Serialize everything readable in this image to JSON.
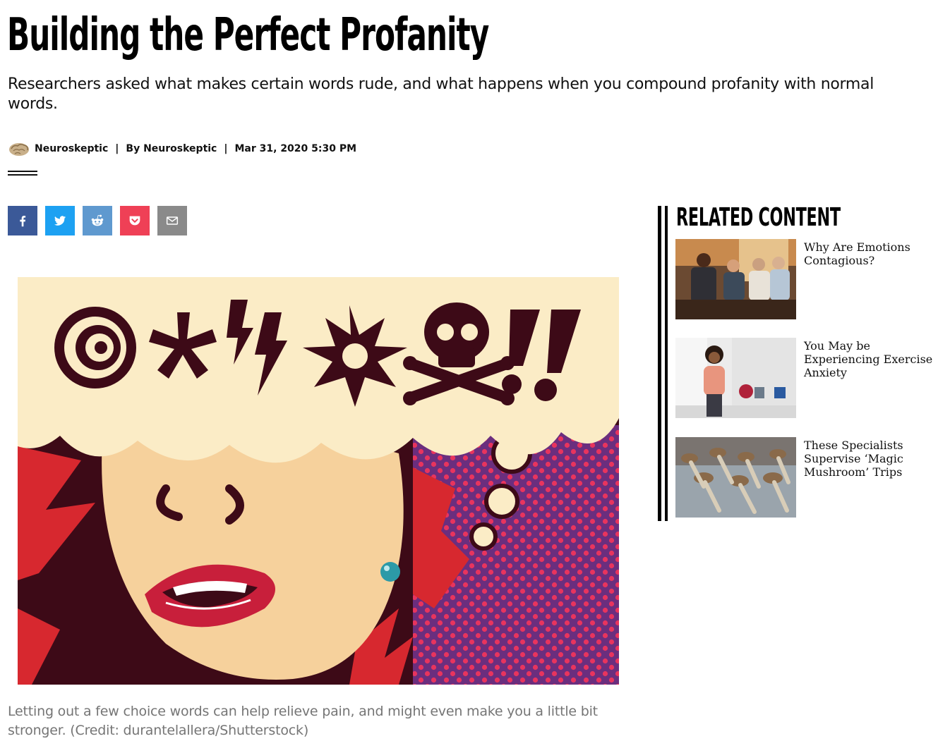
{
  "article": {
    "headline": "Building the Perfect Profanity",
    "dek": "Researchers asked what makes certain words rude, and what happens when you compound profanity with normal words.",
    "byline": {
      "blog_name": "Neuroskeptic",
      "separator": "|",
      "author_label": "By Neuroskeptic",
      "date": "Mar 31, 2020 5:30 PM"
    },
    "share": [
      {
        "network": "facebook",
        "icon": "facebook-icon",
        "color": "#3b5998"
      },
      {
        "network": "twitter",
        "icon": "twitter-icon",
        "color": "#1da1f2"
      },
      {
        "network": "reddit",
        "icon": "reddit-icon",
        "color": "#5f99cf"
      },
      {
        "network": "pocket",
        "icon": "pocket-icon",
        "color": "#ef4056"
      },
      {
        "network": "email",
        "icon": "email-icon",
        "color": "#8a8a8a"
      }
    ],
    "hero_caption": "Letting out a few choice words can help relieve pain, and might even make you a little bit stronger. (Credit: durantelallera/Shutterstock)"
  },
  "related": {
    "title": "RELATED CONTENT",
    "items": [
      {
        "title": "Why Are Emotions Contagious?"
      },
      {
        "title": "You May be Experiencing Exercise Anxiety"
      },
      {
        "title": "These Specialists Supervise ‘Magic Mushroom’ Trips"
      }
    ]
  },
  "colors": {
    "text": "#111111",
    "caption": "#757575",
    "hero_cream": "#fbecc6",
    "hero_maroon": "#3d0a17",
    "hero_red": "#d7282f",
    "hero_skin": "#f6d19c",
    "hero_purple": "#6b2e7e"
  }
}
